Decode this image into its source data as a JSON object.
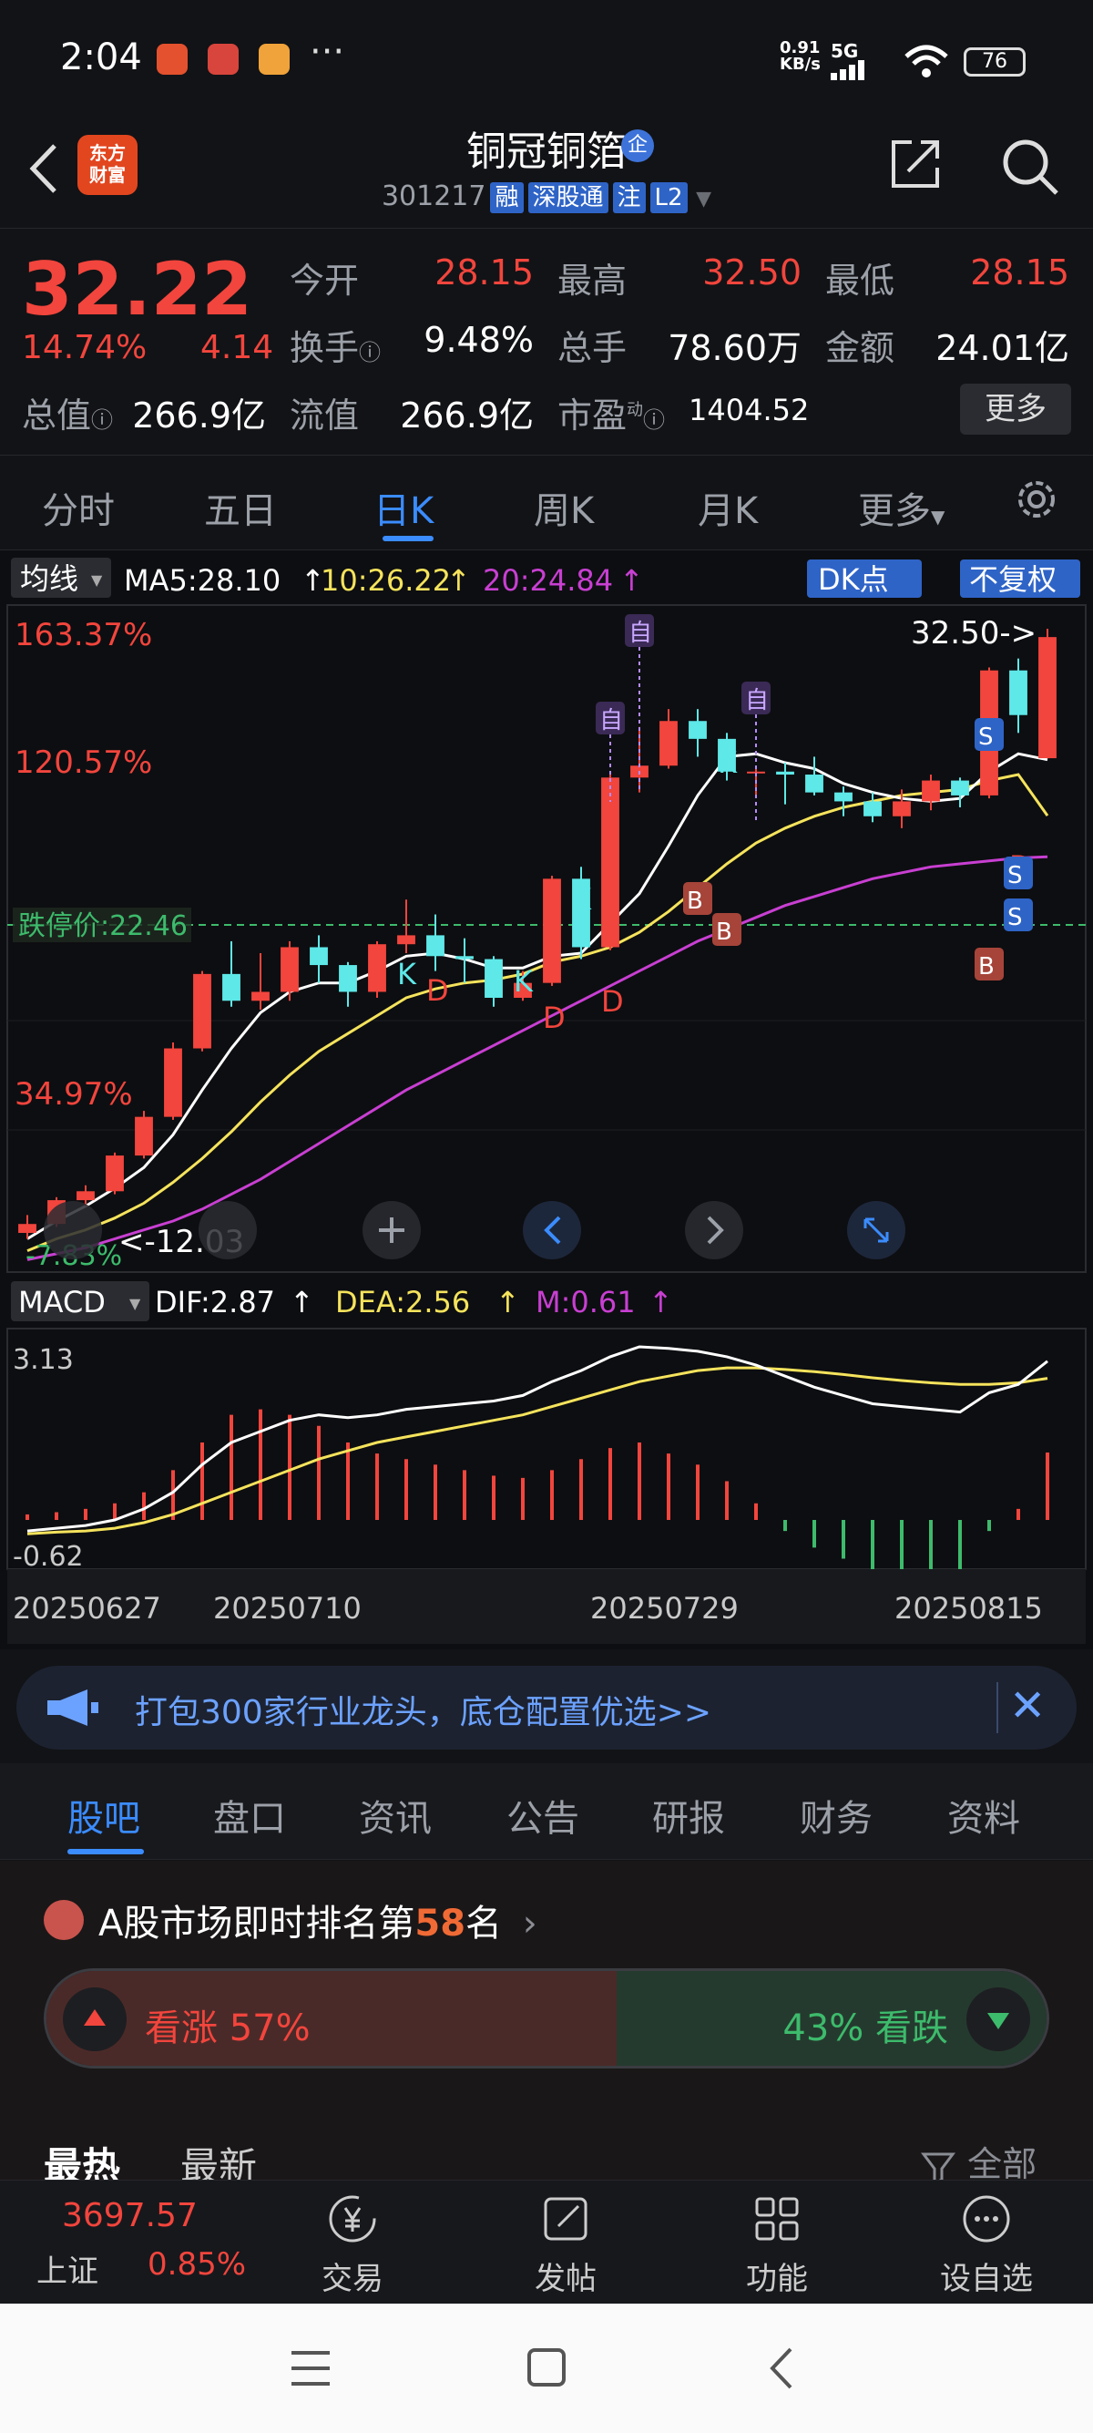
{
  "status_bar": {
    "time": "2:04",
    "more": "···",
    "net_speed": "0.91",
    "net_unit": "KB/s",
    "net_type": "5G",
    "battery": "76"
  },
  "header": {
    "app_logo": "东方\n财富",
    "stock_name": "铜冠铜箔",
    "badge": "企",
    "code": "301217",
    "tags": [
      "融",
      "深股通",
      "注",
      "L2"
    ]
  },
  "quote": {
    "price": "32.22",
    "change_pct": "14.74%",
    "change_abs": "4.14",
    "open_label": "今开",
    "open": "28.15",
    "high_label": "最高",
    "high": "32.50",
    "low_label": "最低",
    "low": "28.15",
    "turnover_label": "换手",
    "turnover": "9.48%",
    "volume_label": "总手",
    "volume": "78.60万",
    "amount_label": "金额",
    "amount": "24.01亿",
    "mktcap_label": "总值",
    "mktcap": "266.9亿",
    "float_label": "流值",
    "float_cap": "266.9亿",
    "pe_label": "市盈",
    "pe_sup": "动",
    "pe": "1404.52",
    "more_label": "更多"
  },
  "period_tabs": [
    "分时",
    "五日",
    "日K",
    "周K",
    "月K",
    "更多"
  ],
  "period_active": 2,
  "chart_header": {
    "ma_selector": "均线",
    "ma5": "MA5:28.10",
    "ma10": "10:26.22",
    "ma20": "20:24.84",
    "dk_button": "DK点",
    "adjust_button": "不复权"
  },
  "chart_labels": {
    "pct_top": "163.37%",
    "pct_2": "120.57%",
    "limit_down": "跌停价:22.46",
    "pct_3": "34.97%",
    "pct_bottom": "-7.83%",
    "low_marker": "<-12.03",
    "high_marker": "32.50->",
    "macd_selector": "MACD",
    "dif": "DIF:2.87",
    "dea": "DEA:2.56",
    "m": "M:0.61",
    "macd_top": "3.13",
    "macd_bottom": "-0.62",
    "dates": [
      "20250627",
      "20250710",
      "20250729",
      "20250815"
    ],
    "signal_zi": "自",
    "signal_k": "K",
    "signal_d": "D",
    "signal_b": "B",
    "signal_s": "S"
  },
  "chart_data": {
    "type": "candlestick",
    "ohlc": [
      [
        12.2,
        12.8,
        12.0,
        12.5
      ],
      [
        12.5,
        13.4,
        12.4,
        13.3
      ],
      [
        13.3,
        13.8,
        13.1,
        13.6
      ],
      [
        13.6,
        14.9,
        13.5,
        14.8
      ],
      [
        14.8,
        16.3,
        14.7,
        16.1
      ],
      [
        16.1,
        18.6,
        16.0,
        18.4
      ],
      [
        18.4,
        21.0,
        18.3,
        20.9
      ],
      [
        20.9,
        22.0,
        19.8,
        20.0
      ],
      [
        20.0,
        21.6,
        19.7,
        20.3
      ],
      [
        20.3,
        22.0,
        20.0,
        21.8
      ],
      [
        21.8,
        22.2,
        20.6,
        21.2
      ],
      [
        21.2,
        21.3,
        19.8,
        20.3
      ],
      [
        20.3,
        22.0,
        20.1,
        21.9
      ],
      [
        21.9,
        23.4,
        21.6,
        22.2
      ],
      [
        22.2,
        22.9,
        21.0,
        21.5
      ],
      [
        21.5,
        22.1,
        20.6,
        21.4
      ],
      [
        21.4,
        21.5,
        19.8,
        20.1
      ],
      [
        20.1,
        21.0,
        20.0,
        20.6
      ],
      [
        20.6,
        24.2,
        20.5,
        24.1
      ],
      [
        24.1,
        24.5,
        21.4,
        21.8
      ],
      [
        21.8,
        27.6,
        21.7,
        27.5
      ],
      [
        27.5,
        29.2,
        27.0,
        27.9
      ],
      [
        27.9,
        29.8,
        27.8,
        29.4
      ],
      [
        29.4,
        29.8,
        28.2,
        28.8
      ],
      [
        28.8,
        29.0,
        27.4,
        27.7
      ],
      [
        27.7,
        27.9,
        26.9,
        27.7
      ],
      [
        27.7,
        28.0,
        26.6,
        27.6
      ],
      [
        27.6,
        28.2,
        26.9,
        27.0
      ],
      [
        27.0,
        27.2,
        26.2,
        26.7
      ],
      [
        26.7,
        27.0,
        26.0,
        26.2
      ],
      [
        26.2,
        27.1,
        25.8,
        26.7
      ],
      [
        26.7,
        27.6,
        26.4,
        27.4
      ],
      [
        27.4,
        27.5,
        26.5,
        26.9
      ],
      [
        26.9,
        31.2,
        26.8,
        31.1
      ],
      [
        31.1,
        31.5,
        29.0,
        29.6
      ],
      [
        28.15,
        32.5,
        28.15,
        32.22
      ]
    ],
    "ma5": [
      12.0,
      12.6,
      13.1,
      13.7,
      14.4,
      15.5,
      17.0,
      18.4,
      19.6,
      20.3,
      20.6,
      20.6,
      21.0,
      21.5,
      21.6,
      21.4,
      21.1,
      21.1,
      21.5,
      21.6,
      22.6,
      23.6,
      25.2,
      26.9,
      28.2,
      28.3,
      28.0,
      27.8,
      27.3,
      27.0,
      26.8,
      26.7,
      26.8,
      27.7,
      28.3,
      28.1
    ],
    "ma10": [
      11.6,
      12.0,
      12.3,
      12.7,
      13.2,
      13.9,
      14.7,
      15.6,
      16.6,
      17.5,
      18.3,
      18.9,
      19.5,
      20.1,
      20.4,
      20.6,
      20.7,
      20.9,
      21.3,
      21.5,
      21.8,
      22.3,
      23.0,
      23.8,
      24.6,
      25.3,
      25.8,
      26.2,
      26.5,
      26.7,
      26.9,
      27.0,
      27.1,
      27.4,
      27.6,
      26.22
    ],
    "ma20": [
      11.3,
      11.5,
      11.7,
      12.0,
      12.3,
      12.6,
      13.0,
      13.5,
      14.0,
      14.6,
      15.2,
      15.8,
      16.4,
      17.0,
      17.5,
      18.0,
      18.5,
      19.0,
      19.5,
      20.0,
      20.5,
      21.0,
      21.5,
      22.0,
      22.4,
      22.8,
      23.2,
      23.5,
      23.8,
      24.1,
      24.3,
      24.5,
      24.6,
      24.7,
      24.8,
      24.84
    ],
    "dif": [
      -0.2,
      -0.15,
      -0.1,
      0.0,
      0.2,
      0.5,
      1.0,
      1.4,
      1.6,
      1.8,
      1.9,
      1.85,
      1.9,
      2.0,
      2.05,
      2.1,
      2.15,
      2.25,
      2.5,
      2.7,
      2.95,
      3.13,
      3.1,
      3.05,
      2.95,
      2.8,
      2.6,
      2.4,
      2.25,
      2.1,
      2.05,
      2.0,
      1.95,
      2.3,
      2.45,
      2.87
    ],
    "dea": [
      -0.25,
      -0.22,
      -0.2,
      -0.15,
      -0.05,
      0.1,
      0.3,
      0.5,
      0.7,
      0.9,
      1.1,
      1.25,
      1.4,
      1.5,
      1.6,
      1.7,
      1.8,
      1.9,
      2.05,
      2.2,
      2.35,
      2.5,
      2.6,
      2.7,
      2.75,
      2.75,
      2.72,
      2.68,
      2.63,
      2.57,
      2.52,
      2.48,
      2.45,
      2.45,
      2.48,
      2.56
    ],
    "macd_hist": [
      0.05,
      0.07,
      0.1,
      0.15,
      0.25,
      0.45,
      0.7,
      0.95,
      1.0,
      0.95,
      0.85,
      0.7,
      0.6,
      0.55,
      0.5,
      0.45,
      0.4,
      0.38,
      0.45,
      0.55,
      0.65,
      0.7,
      0.6,
      0.5,
      0.35,
      0.15,
      -0.1,
      -0.25,
      -0.35,
      -0.45,
      -0.45,
      -0.45,
      -0.45,
      -0.1,
      0.1,
      0.61
    ],
    "x_ticks": [
      "20250627",
      "20250710",
      "20250729",
      "20250815"
    ]
  },
  "ad": {
    "text": "打包300家行业龙头，底仓配置优选>>",
    "close": "✕"
  },
  "content_tabs": [
    "股吧",
    "盘口",
    "资讯",
    "公告",
    "研报",
    "财务",
    "资料"
  ],
  "content_active": 0,
  "ranking": {
    "prefix": "A股市场即时排名第",
    "rank": "58",
    "suffix": "名",
    "arrow": "›"
  },
  "sentiment": {
    "bull_label": "看涨 57%",
    "bear_label": "43% 看跌",
    "bull_pct": 57
  },
  "sort": {
    "hot": "最热",
    "new": "最新",
    "filter": "全部"
  },
  "bottom_bar": {
    "index_value": "3697.57",
    "index_name": "上证",
    "index_pct": "0.85%",
    "items": [
      "交易",
      "发帖",
      "功能",
      "设自选"
    ]
  },
  "colors": {
    "up": "#f2453d",
    "down": "#5ee8e8",
    "accent": "#3b8cff",
    "ma5": "#ffffff",
    "ma10": "#f5e35c",
    "ma20": "#c83fd2"
  }
}
